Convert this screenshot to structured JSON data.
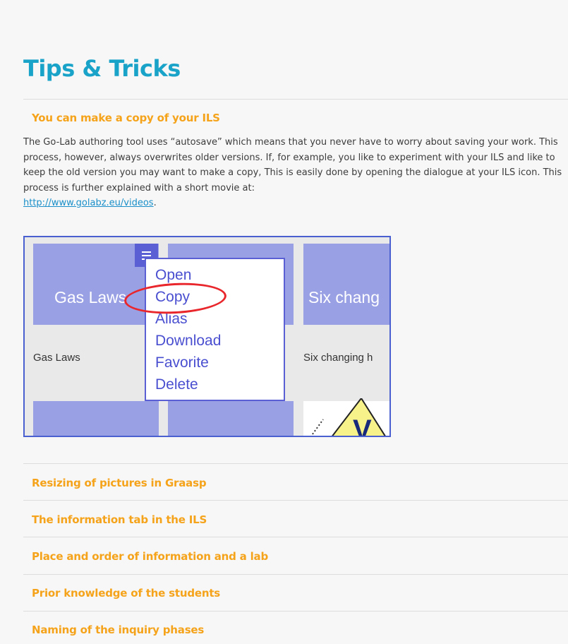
{
  "page": {
    "title": "Tips & Tricks"
  },
  "expanded_tip": {
    "title": "You can make a copy of your ILS",
    "text": "The Go-Lab authoring tool uses “autosave” which means that you never have to worry about saving your work. This process, however, always overwrites older versions. If, for example, you like to experiment with your ILS and like to keep the old version you may want to make a copy, This is easily done by opening the dialogue at your ILS icon. This process is further explained with a short movie at:",
    "link": "http://www.golabz.eu/videos",
    "link_suffix": "."
  },
  "figure": {
    "tiles": [
      {
        "label": "Gas Laws",
        "caption": "Gas Laws"
      },
      {
        "label": "",
        "caption": ""
      },
      {
        "label": "Six chang",
        "caption": "Six changing h"
      }
    ],
    "menu_icon": "menu-lines-icon",
    "menu_items": [
      "Open",
      "Copy",
      "Alias",
      "Download",
      "Favorite",
      "Delete"
    ],
    "highlighted_item": "Copy",
    "warning_letter": "V",
    "colors": {
      "tile": "#9aa0e4",
      "menu_text": "#4a4fd0",
      "highlight": "#e8262b"
    }
  },
  "collapsed_tips": [
    "Resizing of pictures in Graasp",
    "The information tab in the ILS",
    "Place and order of information and a lab",
    "Prior knowledge of the students",
    "Naming of the inquiry phases"
  ],
  "colors": {
    "title": "#1aa3c9",
    "section": "#f5a31a",
    "link": "#1a8fc9"
  }
}
